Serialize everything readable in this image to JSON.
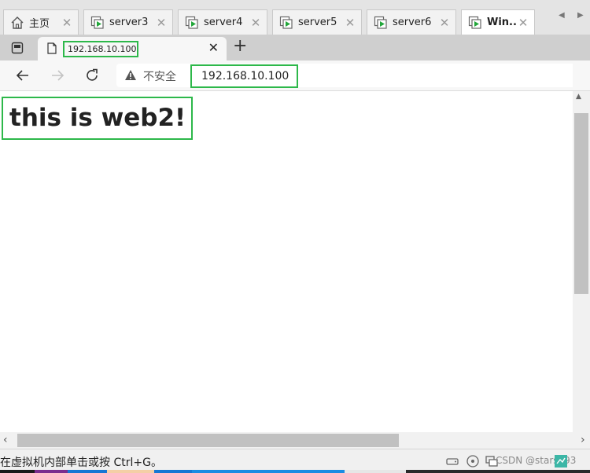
{
  "vm_tabs": [
    {
      "label": "主页",
      "icon": "home-icon"
    },
    {
      "label": "server3",
      "icon": "vm-icon"
    },
    {
      "label": "server4",
      "icon": "vm-icon"
    },
    {
      "label": "server5",
      "icon": "vm-icon"
    },
    {
      "label": "server6",
      "icon": "vm-icon"
    },
    {
      "label": "Win...",
      "icon": "vm-icon",
      "active": true
    }
  ],
  "browser": {
    "tab_title": "192.168.10.100",
    "insecure_label": "不安全",
    "url": "192.168.10.100"
  },
  "page": {
    "heading": "this is web2!"
  },
  "status": {
    "hint": "在虚拟机内部单击或按 Ctrl+G。",
    "watermark": "CSDN @stars293"
  },
  "colors": {
    "highlight": "#2db84a",
    "vm_icon_green": "#22a63a"
  }
}
